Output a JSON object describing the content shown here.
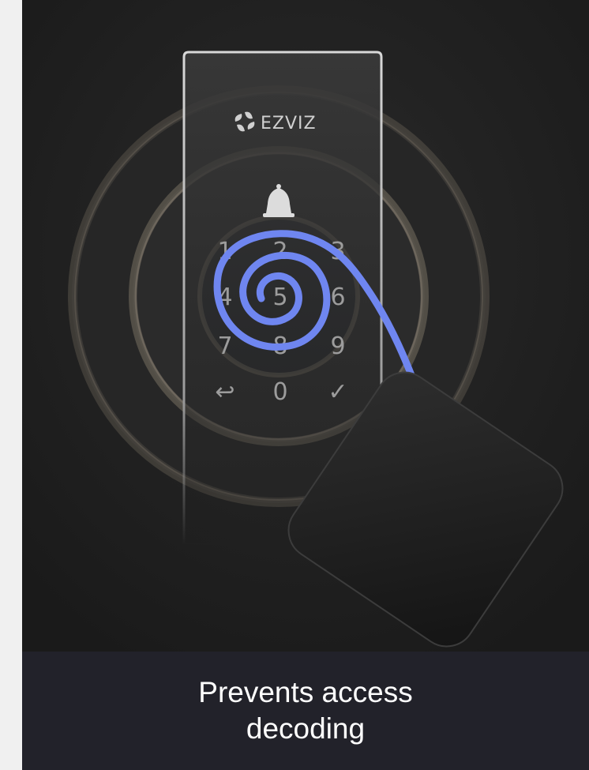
{
  "brand": {
    "name": "EZVIZ",
    "logo_icon": "ezviz-fan-logo-icon"
  },
  "keypad": {
    "bell_icon": "bell-icon",
    "keys": [
      "1",
      "2",
      "3",
      "4",
      "5",
      "6",
      "7",
      "8",
      "9",
      "↩",
      "0",
      "✓"
    ]
  },
  "caption": "Prevents access decoding",
  "colors": {
    "background": "#1d1d1d",
    "caption_bar": "#22222a",
    "spiral": "#6f86f0",
    "glow": "#d9cbb3",
    "caption_text": "#ffffff"
  }
}
